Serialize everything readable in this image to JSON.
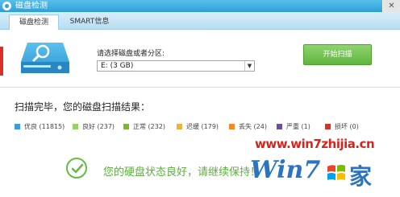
{
  "window": {
    "title": "磁盘检测",
    "close_glyph": "✕"
  },
  "tabs": [
    {
      "label": "磁盘检测"
    },
    {
      "label": "SMART信息"
    }
  ],
  "scan": {
    "select_label": "请选择磁盘或者分区:",
    "selected_value": "E: (3 GB)",
    "start_button": "开始扫描"
  },
  "result": {
    "title": "扫描完毕，您的磁盘扫描结果：",
    "legend": [
      {
        "label": "优良 (11815)",
        "color": "#3d9bd6"
      },
      {
        "label": "良好 (237)",
        "color": "#9bcf6a"
      },
      {
        "label": "正常 (232)",
        "color": "#7fb531"
      },
      {
        "label": "迟缓 (179)",
        "color": "#f3b12d"
      },
      {
        "label": "丢失 (24)",
        "color": "#f08a2a"
      },
      {
        "label": "严重 (1)",
        "color": "#6a4ea0"
      },
      {
        "label": "损坏 (0)",
        "color": "#d9302b"
      }
    ],
    "status_text": "您的硬盘状态良好，请继续保持！"
  },
  "watermark": {
    "url": "www.win7zhijia.cn",
    "brand": "Win7",
    "suffix": "家"
  },
  "icons": {
    "disk": "disk-search-icon",
    "check": "check-circle-icon",
    "dropdown": "chevron-down-icon"
  },
  "colors": {
    "accent": "#2f9fd8",
    "success": "#5aaf3a",
    "button": "#6ec24a"
  }
}
